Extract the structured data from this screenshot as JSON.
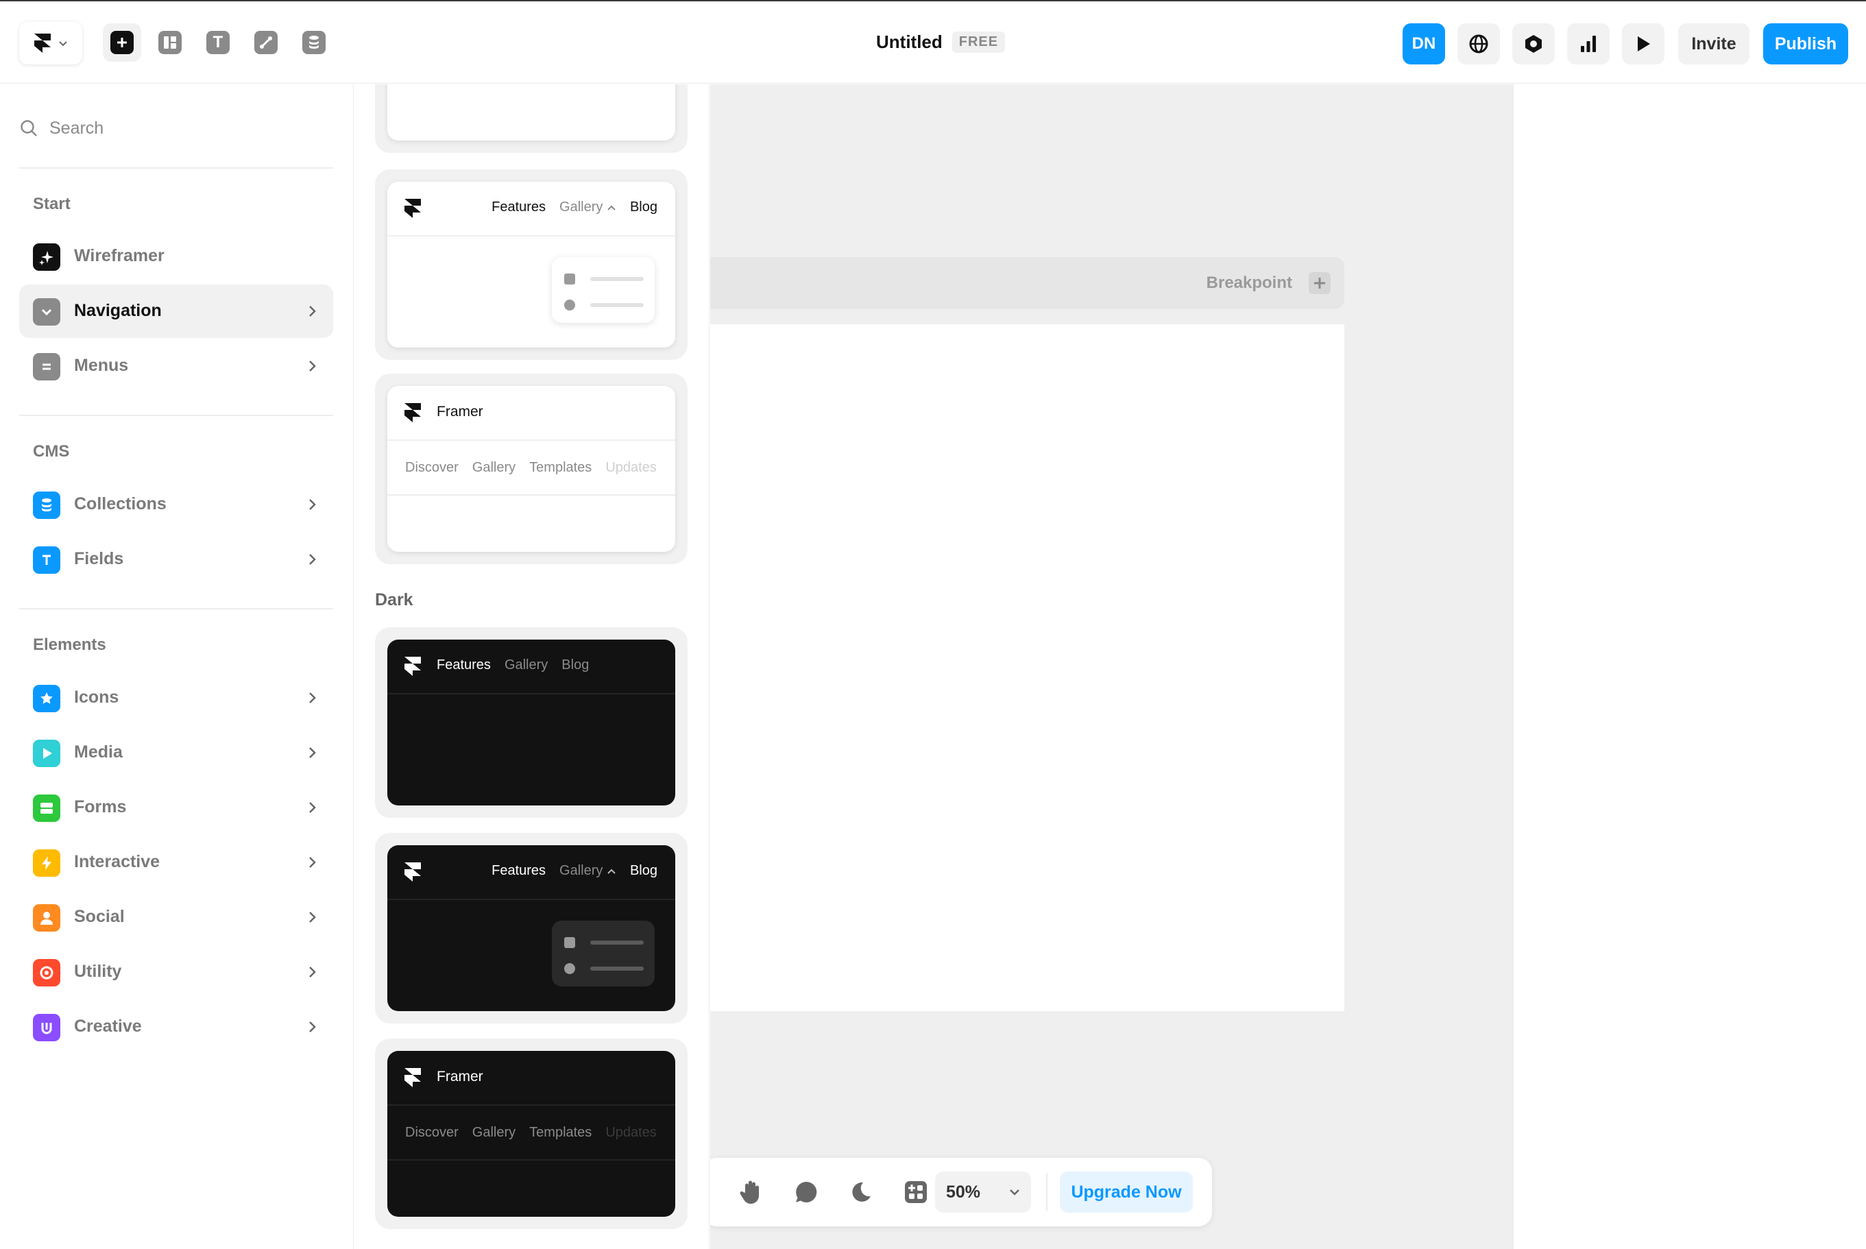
{
  "topbar": {
    "title": "Untitled",
    "plan_badge": "FREE",
    "avatar_initials": "DN",
    "invite_label": "Invite",
    "publish_label": "Publish",
    "tools": [
      "insert-icon",
      "layout-icon",
      "text-icon",
      "vector-icon",
      "cms-icon"
    ],
    "right_icons": [
      "globe-icon",
      "settings-icon",
      "analytics-icon",
      "preview-play-icon"
    ]
  },
  "sidebar": {
    "search_placeholder": "Search",
    "sections": {
      "start": "Start",
      "cms": "CMS",
      "elements": "Elements"
    },
    "start_items": [
      {
        "label": "Wireframer",
        "icon": "sparkle-icon",
        "color": "#111111",
        "selected": false,
        "has_chevron": false
      },
      {
        "label": "Navigation",
        "icon": "chevron-down-icon",
        "color": "#8a8a8a",
        "selected": true,
        "has_chevron": true
      },
      {
        "label": "Menus",
        "icon": "menu-lines-icon",
        "color": "#8a8a8a",
        "selected": false,
        "has_chevron": true
      }
    ],
    "cms_items": [
      {
        "label": "Collections",
        "icon": "database-icon",
        "color": "#0a99ff",
        "has_chevron": true
      },
      {
        "label": "Fields",
        "icon": "text-t-icon",
        "color": "#0a99ff",
        "has_chevron": true
      }
    ],
    "element_items": [
      {
        "label": "Icons",
        "icon": "star-icon",
        "color": "#0a99ff"
      },
      {
        "label": "Media",
        "icon": "play-icon",
        "color": "#2fd0d6"
      },
      {
        "label": "Forms",
        "icon": "form-icon",
        "color": "#2dc83c"
      },
      {
        "label": "Interactive",
        "icon": "bolt-icon",
        "color": "#ffbb00"
      },
      {
        "label": "Social",
        "icon": "person-icon",
        "color": "#ff8a1f"
      },
      {
        "label": "Utility",
        "icon": "target-icon",
        "color": "#ff4a2e"
      },
      {
        "label": "Creative",
        "icon": "creative-u-icon",
        "color": "#8a4dff"
      }
    ]
  },
  "panel": {
    "dark_section_label": "Dark",
    "light_cards": {
      "dropdown_card": {
        "links": [
          "Features",
          "Gallery",
          "Blog"
        ]
      },
      "two_row_card": {
        "brand": "Framer",
        "sub_links": [
          "Discover",
          "Gallery",
          "Templates",
          "Updates"
        ]
      }
    },
    "dark_cards": {
      "simple_card": {
        "links": [
          "Features",
          "Gallery",
          "Blog"
        ]
      },
      "dropdown_card": {
        "links": [
          "Features",
          "Gallery",
          "Blog"
        ]
      },
      "two_row_card": {
        "brand": "Framer",
        "sub_links": [
          "Discover",
          "Gallery",
          "Templates",
          "Updates"
        ]
      }
    }
  },
  "canvas": {
    "breakpoint_label": "Breakpoint",
    "zoom": "50%",
    "upgrade_label": "Upgrade Now",
    "bottom_tools": [
      "hand-icon",
      "comment-icon",
      "moon-icon",
      "grid-plus-icon"
    ]
  }
}
